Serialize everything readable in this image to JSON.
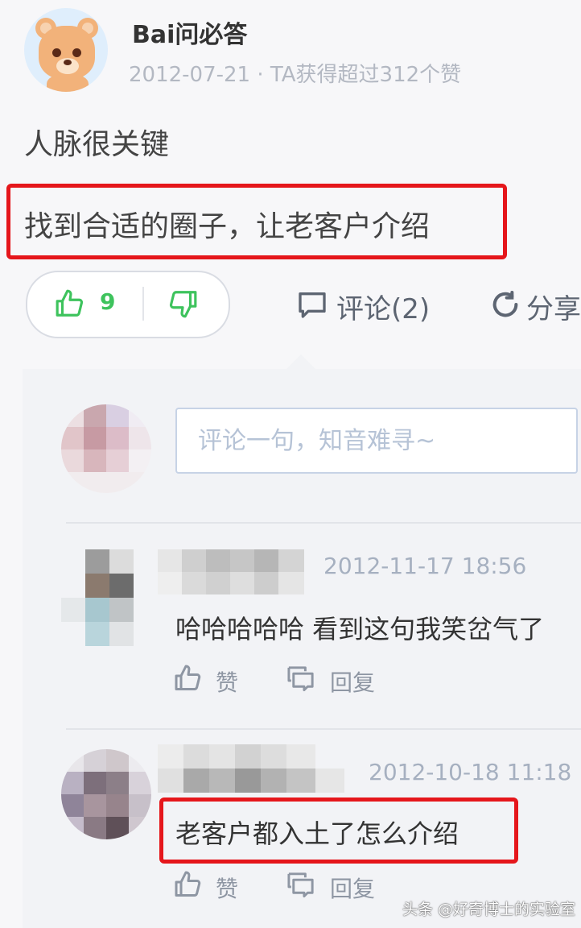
{
  "post": {
    "username": "Bai问必答",
    "meta": "2012-07-21 · TA获得超过312个赞",
    "question": "人脉很关键",
    "answer": "找到合适的圈子，让老客户介绍"
  },
  "actions": {
    "like_count": "9",
    "comment_label": "评论(2)",
    "share_label": "分享"
  },
  "comment_box": {
    "placeholder": "评论一句，知音难寻~"
  },
  "comments": [
    {
      "timestamp": "2012-11-17 18:56",
      "text": "哈哈哈哈哈 看到这句我笑岔气了",
      "like_label": "赞",
      "reply_label": "回复"
    },
    {
      "timestamp": "2012-10-18 11:18",
      "text": "老客户都入土了怎么介绍",
      "like_label": "赞",
      "reply_label": "回复"
    }
  ],
  "watermark": "头条 @好奇博士的实验室",
  "colors": {
    "highlight": "#e5161b",
    "like_green": "#3ec35d",
    "timestamp": "#a6b0c0"
  },
  "icons": [
    "thumbs-up-icon",
    "thumbs-down-icon",
    "speech-bubble-icon",
    "share-arrow-icon",
    "reply-bubble-icon"
  ]
}
